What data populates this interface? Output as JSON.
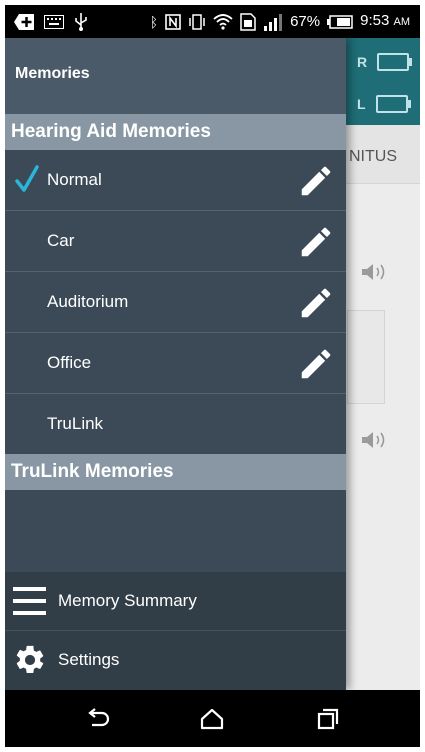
{
  "status_bar": {
    "battery_percent": "67%",
    "time": "9:53",
    "ampm": "AM",
    "icons": [
      "plus-icon",
      "keyboard-icon",
      "usb-icon",
      "bluetooth-icon",
      "nfc-icon",
      "vibrate-icon",
      "wifi-icon",
      "sim-icon",
      "signal-icon",
      "battery-icon"
    ]
  },
  "background": {
    "battery_right_label": "R",
    "battery_left_label": "L",
    "tab_partial": "NITUS"
  },
  "drawer": {
    "title": "Memories",
    "sections": {
      "hearing_aid": "Hearing Aid Memories",
      "trulink": "TruLink Memories"
    },
    "memories": [
      {
        "label": "Normal",
        "selected": true,
        "editable": true
      },
      {
        "label": "Car",
        "selected": false,
        "editable": true
      },
      {
        "label": "Auditorium",
        "selected": false,
        "editable": true
      },
      {
        "label": "Office",
        "selected": false,
        "editable": true
      },
      {
        "label": "TruLink",
        "selected": false,
        "editable": false
      }
    ],
    "bottom_menu": [
      {
        "label": "Memory Summary",
        "icon": "menu-icon"
      },
      {
        "label": "Settings",
        "icon": "gear-icon"
      }
    ]
  },
  "colors": {
    "check": "#29b6d8",
    "drawer_bg": "#3b4a56",
    "section_bg": "#8897a3",
    "header_bg": "#1f6e77"
  }
}
